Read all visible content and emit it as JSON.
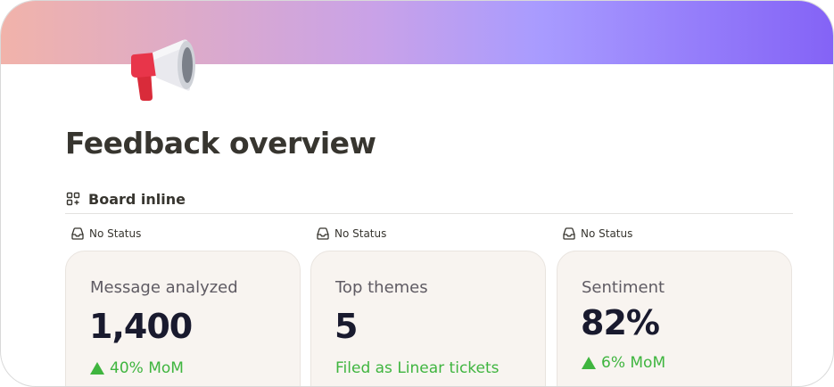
{
  "page": {
    "title": "Feedback overview",
    "cover_colors": [
      "#f1b3aa",
      "#a89bff",
      "#8463f6"
    ],
    "icon": "megaphone-icon"
  },
  "view": {
    "icon": "board-view-icon",
    "label": "Board inline"
  },
  "columns": [
    {
      "status": "No Status",
      "card": {
        "title": "Message analyzed",
        "value": "1,400",
        "delta": "40% MoM",
        "delta_arrow": "up-triangle-icon"
      }
    },
    {
      "status": "No Status",
      "card": {
        "title": "Top themes",
        "value": "5",
        "delta": "Filed as Linear tickets",
        "delta_arrow": null
      }
    },
    {
      "status": "No Status",
      "card": {
        "title": "Sentiment",
        "value": "82%",
        "delta": "6% MoM",
        "delta_arrow": "up-triangle-icon"
      }
    }
  ],
  "colors": {
    "positive": "#3fb53f",
    "card_bg": "#f8f4f0",
    "title_text": "#37352f"
  }
}
